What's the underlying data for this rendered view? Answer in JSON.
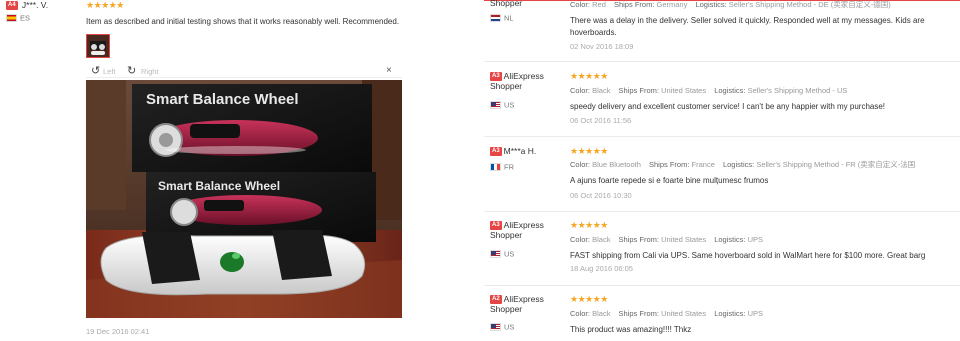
{
  "left_review": {
    "level": "A4",
    "user": "J***. V.",
    "stars": "★★★★★",
    "country": "ES",
    "text": "Item as described and initial testing shows that it works reasonably well. Recommended.",
    "photo_viewer": {
      "left_label": "Left",
      "right_label": "Right",
      "close": "×",
      "box_text_1": "Smart Balance Wheel",
      "box_text_2": "Smart Balance Wheel"
    },
    "date": "19 Dec 2016 02:41"
  },
  "reviews": [
    {
      "level": "",
      "user": "Shopper",
      "stars": "",
      "country": "NL",
      "meta": {
        "color_key": "Color:",
        "color": "Red",
        "ships_key": "Ships From:",
        "ships": "Germany",
        "logistics_key": "Logistics:",
        "logistics": "Seller's Shipping Method - DE (卖家自定义-德国)"
      },
      "text": "There was a delay in the delivery. Seller solved it quickly. Responded well at my messages. Kids are",
      "text2": "hoverboards.",
      "date": "02 Nov 2016 18:09"
    },
    {
      "level": "A3",
      "user": "AliExpress",
      "user2": "Shopper",
      "stars": "★★★★★",
      "country": "US",
      "meta": {
        "color_key": "Color:",
        "color": "Black",
        "ships_key": "Ships From:",
        "ships": "United States",
        "logistics_key": "Logistics:",
        "logistics": "Seller's Shipping Method - US"
      },
      "text": "speedy delivery and excellent customer service! I can't be any happier with my purchase!",
      "date": "06 Oct 2016 11:56"
    },
    {
      "level": "A3",
      "user": "M***a H.",
      "stars": "★★★★★",
      "country": "FR",
      "meta": {
        "color_key": "Color:",
        "color": "Blue Bluetooth",
        "ships_key": "Ships From:",
        "ships": "France",
        "logistics_key": "Logistics:",
        "logistics": "Seller's Shipping Method - FR (卖家自定义-法国"
      },
      "text": "A ajuns foarte repede si e foarte bine mulțumesc frumos",
      "date": "06 Oct 2016 10:30"
    },
    {
      "level": "A3",
      "user": "AliExpress",
      "user2": "Shopper",
      "stars": "★★★★★",
      "country": "US",
      "meta": {
        "color_key": "Color:",
        "color": "Black",
        "ships_key": "Ships From:",
        "ships": "United States",
        "logistics_key": "Logistics:",
        "logistics": "UPS"
      },
      "text": "FAST shipping from Cali via UPS. Same hoverboard sold in WalMart here for $100 more. Great barg",
      "date": "18 Aug 2016 06:05"
    },
    {
      "level": "A2",
      "user": "AliExpress",
      "user2": "Shopper",
      "stars": "★★★★★",
      "country": "US",
      "meta": {
        "color_key": "Color:",
        "color": "Black",
        "ships_key": "Ships From:",
        "ships": "United States",
        "logistics_key": "Logistics:",
        "logistics": "UPS"
      },
      "text": "This product was amazing!!!! Thkz",
      "date": ""
    }
  ]
}
